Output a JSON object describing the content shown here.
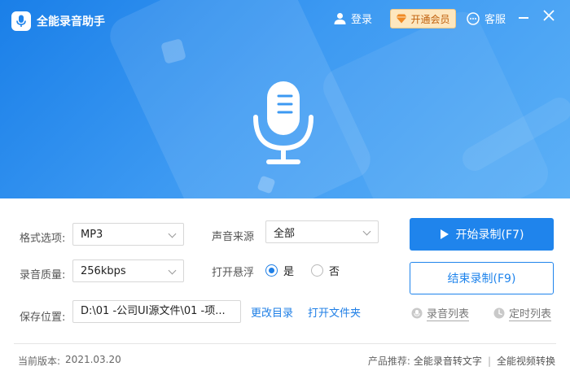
{
  "app": {
    "title": "全能录音助手",
    "login_label": "登录",
    "vip_label": "开通会员",
    "service_label": "客服"
  },
  "form": {
    "format_label": "格式选项:",
    "format_value": "MP3",
    "source_label": "声音来源",
    "source_value": "全部",
    "quality_label": "录音质量:",
    "quality_value": "256kbps",
    "float_label": "打开悬浮",
    "float_yes": "是",
    "float_no": "否",
    "float_selected": "是",
    "save_label": "保存位置:",
    "save_path": "D:\\01 -公司UI源文件\\01 -项...",
    "change_dir": "更改目录",
    "open_folder": "打开文件夹"
  },
  "actions": {
    "start_label": "开始录制(F7)",
    "stop_label": "结束录制(F9)",
    "record_list": "录音列表",
    "schedule_list": "定时列表"
  },
  "footer": {
    "version_label": "当前版本:",
    "version_value": "2021.03.20",
    "recommend_label": "产品推荐:",
    "product_1": "全能录音转文字",
    "product_2": "全能视频转换"
  },
  "colors": {
    "accent": "#1f84ec",
    "vip_bg": "#fde7bf",
    "vip_text": "#c0610f"
  }
}
